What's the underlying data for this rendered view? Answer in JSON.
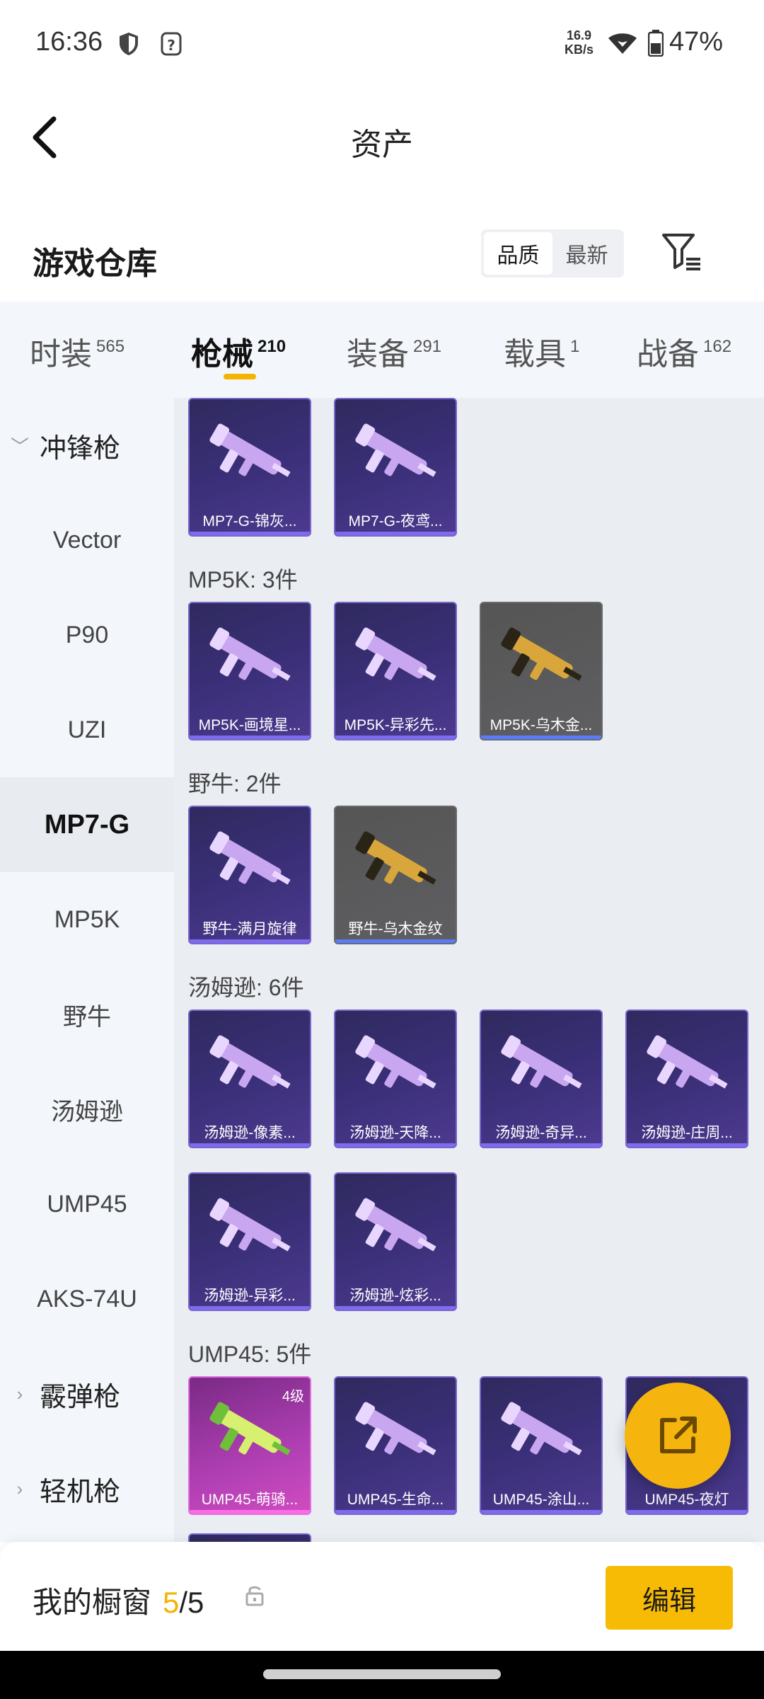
{
  "status_bar": {
    "time": "16:36",
    "net_speed_value": "16.9",
    "net_speed_unit": "KB/s",
    "battery": "47%"
  },
  "header": {
    "title": "资产",
    "back_icon": "chevron-left-icon"
  },
  "warehouse": {
    "title": "游戏仓库",
    "sort_options": [
      "品质",
      "最新"
    ],
    "active_sort": "品质",
    "filter_icon": "filter-icon"
  },
  "tabs": [
    {
      "label": "时装",
      "count": "565"
    },
    {
      "label": "枪械",
      "count": "210",
      "active": true
    },
    {
      "label": "装备",
      "count": "291"
    },
    {
      "label": "载具",
      "count": "1"
    },
    {
      "label": "战备",
      "count": "162"
    }
  ],
  "sidebar": {
    "categories": [
      {
        "label": "冲锋枪",
        "expanded": true
      },
      {
        "label": "霰弹枪",
        "expanded": false
      },
      {
        "label": "轻机枪",
        "expanded": false
      }
    ],
    "items": [
      "Vector",
      "P90",
      "UZI",
      "MP7-G",
      "MP5K",
      "野牛",
      "汤姆逊",
      "UMP45",
      "AKS-74U"
    ],
    "active_item": "MP7-G"
  },
  "groups": [
    {
      "label": "",
      "items": [
        {
          "name": "MP7-G-锦灰...",
          "style": "purple"
        },
        {
          "name": "MP7-G-夜鸢...",
          "style": "purple"
        }
      ]
    },
    {
      "label": "MP5K: 3件",
      "items": [
        {
          "name": "MP5K-画境星...",
          "style": "purple"
        },
        {
          "name": "MP5K-异彩先...",
          "style": "purple"
        },
        {
          "name": "MP5K-乌木金...",
          "style": "grey"
        }
      ]
    },
    {
      "label": "野牛: 2件",
      "items": [
        {
          "name": "野牛-满月旋律",
          "style": "purple"
        },
        {
          "name": "野牛-乌木金纹",
          "style": "grey"
        }
      ]
    },
    {
      "label": "汤姆逊: 6件",
      "items": [
        {
          "name": "汤姆逊-像素...",
          "style": "purple"
        },
        {
          "name": "汤姆逊-天降...",
          "style": "purple"
        },
        {
          "name": "汤姆逊-奇异...",
          "style": "purple"
        },
        {
          "name": "汤姆逊-庄周...",
          "style": "purple"
        },
        {
          "name": "汤姆逊-异彩...",
          "style": "purple"
        },
        {
          "name": "汤姆逊-炫彩...",
          "style": "purple"
        }
      ]
    },
    {
      "label": "UMP45: 5件",
      "items": [
        {
          "name": "UMP45-萌骑...",
          "style": "pink",
          "level": "4级"
        },
        {
          "name": "UMP45-生命...",
          "style": "purple"
        },
        {
          "name": "UMP45-涂山...",
          "style": "purple"
        },
        {
          "name": "UMP45-夜灯",
          "style": "purple"
        }
      ]
    }
  ],
  "colors": {
    "accent": "#f5b400",
    "card_purple": "#3a2f78",
    "card_grey": "#5a5a5e",
    "card_pink": "#b03fb4"
  },
  "fab": {
    "icon": "share-external-icon"
  },
  "bottom": {
    "showcase_label": "我的橱窗",
    "count_current": "5",
    "count_total": "/5",
    "lock_icon": "lock-icon",
    "edit_label": "编辑"
  }
}
